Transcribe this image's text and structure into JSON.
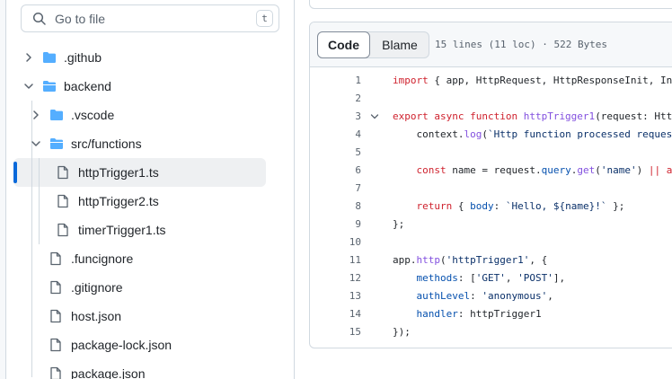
{
  "search": {
    "placeholder": "Go to file",
    "shortcut": "t"
  },
  "tree": [
    {
      "label": ".github",
      "type": "folder",
      "expanded": false
    },
    {
      "label": "backend",
      "type": "folder",
      "expanded": true
    },
    {
      "label": ".vscode",
      "type": "folder",
      "expanded": false
    },
    {
      "label": "src/functions",
      "type": "folder",
      "expanded": true
    },
    {
      "label": "httpTrigger1.ts",
      "type": "file",
      "selected": true
    },
    {
      "label": "httpTrigger2.ts",
      "type": "file"
    },
    {
      "label": "timerTrigger1.ts",
      "type": "file"
    },
    {
      "label": ".funcignore",
      "type": "file"
    },
    {
      "label": ".gitignore",
      "type": "file"
    },
    {
      "label": "host.json",
      "type": "file"
    },
    {
      "label": "package-lock.json",
      "type": "file"
    },
    {
      "label": "package.json",
      "type": "file"
    }
  ],
  "viewer": {
    "tab_code": "Code",
    "tab_blame": "Blame",
    "meta": "15 lines (11 loc) · 522 Bytes"
  },
  "code": {
    "line_numbers": [
      "1",
      "2",
      "3",
      "4",
      "5",
      "6",
      "7",
      "8",
      "9",
      "10",
      "11",
      "12",
      "13",
      "14",
      "15"
    ]
  },
  "colors": {
    "accent": "#0969da",
    "folder": "#54aeff",
    "keyword": "#cf222e",
    "function": "#8250df",
    "string": "#0a3069",
    "property": "#0550ae"
  }
}
